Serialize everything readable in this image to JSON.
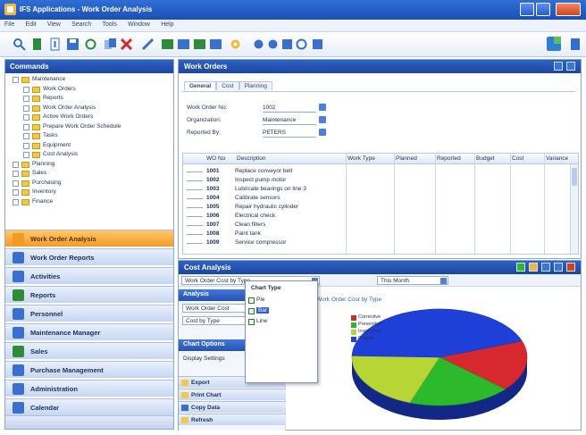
{
  "window": {
    "title": "IFS Applications - Work Order Analysis",
    "colors": {
      "titlebar": "#1b4fb3",
      "accent": "#f39a23"
    }
  },
  "menubar": {
    "items": [
      "File",
      "Edit",
      "View",
      "Search",
      "Tools",
      "Window",
      "Help"
    ]
  },
  "toolbar": {
    "icons": [
      "find-icon",
      "bookmark-icon",
      "new-icon",
      "save-icon",
      "refresh-icon",
      "duplicate-icon",
      "delete-icon",
      "edit-icon",
      "first-record-icon",
      "previous-record-icon",
      "next-record-icon",
      "last-record-icon",
      "settings-icon",
      "chart-icon",
      "report-icon",
      "filter-icon",
      "help-icon"
    ]
  },
  "navigator": {
    "header": "Commands",
    "tree": [
      {
        "label": "Maintenance",
        "level": 0
      },
      {
        "label": "Work Orders",
        "level": 1
      },
      {
        "label": "Reports",
        "level": 1
      },
      {
        "label": "Work Order Analysis",
        "level": 1
      },
      {
        "label": "Active Work Orders",
        "level": 1
      },
      {
        "label": "Prepare Work Order Schedule",
        "level": 1
      },
      {
        "label": "Tasks",
        "level": 1
      },
      {
        "label": "Equipment",
        "level": 1
      },
      {
        "label": "Cost Analysis",
        "level": 1
      },
      {
        "label": "Planning",
        "level": 0
      },
      {
        "label": "Sales",
        "level": 0
      },
      {
        "label": "Purchasing",
        "level": 0
      },
      {
        "label": "Inventory",
        "level": 0
      },
      {
        "label": "Finance",
        "level": 0
      }
    ],
    "buttons": [
      {
        "label": "Work Order Analysis",
        "selected": true
      },
      {
        "label": "Work Order Reports",
        "selected": false
      },
      {
        "label": "Activities",
        "selected": false
      },
      {
        "label": "Reports",
        "selected": false
      },
      {
        "label": "Personnel",
        "selected": false
      },
      {
        "label": "Maintenance Manager",
        "selected": false
      },
      {
        "label": "Sales",
        "selected": false
      },
      {
        "label": "Purchase Management",
        "selected": false
      },
      {
        "label": "Administration",
        "selected": false
      },
      {
        "label": "Calendar",
        "selected": false
      }
    ]
  },
  "details": {
    "header": "Work Orders",
    "tabs": [
      "General",
      "Cost",
      "Planning"
    ],
    "fields": [
      {
        "label": "Work Order No:",
        "value": "1002"
      },
      {
        "label": "Organization:",
        "value": "Maintenance"
      },
      {
        "label": "Reported By:",
        "value": "PETERS"
      }
    ],
    "grid_columns": [
      "WO No",
      "Description",
      "Work Type",
      "Planned",
      "Reported",
      "Budget",
      "Cost",
      "Variance"
    ],
    "grid_rows": [
      {
        "no": "1001",
        "desc": "Replace conveyor belt"
      },
      {
        "no": "1002",
        "desc": "Inspect pump motor"
      },
      {
        "no": "1003",
        "desc": "Lubricate bearings on line 3"
      },
      {
        "no": "1004",
        "desc": "Calibrate sensors"
      },
      {
        "no": "1005",
        "desc": "Repair hydraulic cylinder"
      },
      {
        "no": "1006",
        "desc": "Electrical check"
      },
      {
        "no": "1007",
        "desc": "Clean filters"
      },
      {
        "no": "1008",
        "desc": "Paint tank"
      },
      {
        "no": "1009",
        "desc": "Service compressor"
      }
    ]
  },
  "chart_panel": {
    "header": "Cost Analysis",
    "combo_analysis": "Work Order Cost by Type",
    "combo_period": "This Month",
    "left_sections": [
      {
        "label": "Analysis"
      },
      {
        "label": "Chart Options"
      }
    ],
    "left_inputs": [
      "Work Order Cost",
      "Cost by Type"
    ],
    "left_text": "Display Settings",
    "left_items": [
      "Export",
      "Print Chart",
      "Copy Data",
      "Refresh"
    ],
    "popup": {
      "title": "Chart Type",
      "options": [
        "Pie",
        "Bar",
        "Line"
      ],
      "selected": 1
    },
    "chart_label": "Work Order Cost by Type",
    "chart_data": {
      "type": "pie",
      "title": "Work Order Cost by Type",
      "categories": [
        "Corrective",
        "Preventive",
        "Inspection",
        "Project"
      ],
      "values": [
        17,
        19,
        20,
        44
      ],
      "colors": [
        "#d72830",
        "#2cba2c",
        "#b7d636",
        "#1f3fd9"
      ]
    }
  }
}
